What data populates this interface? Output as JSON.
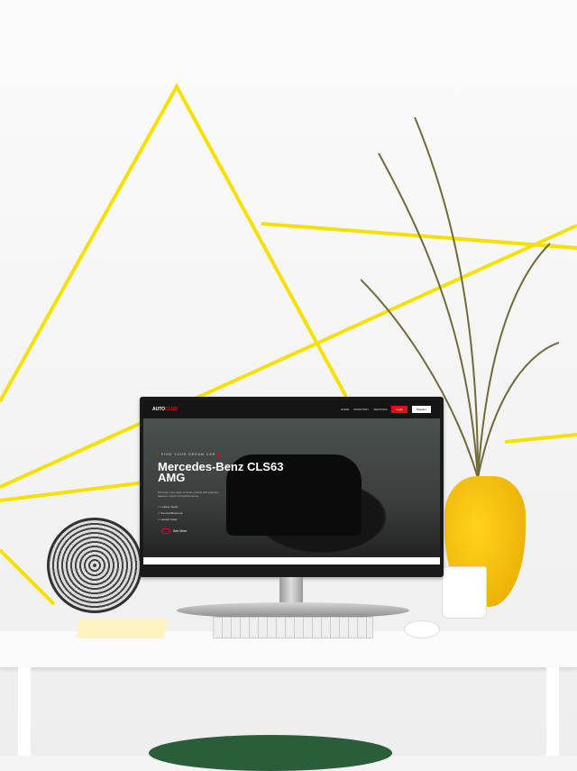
{
  "website": {
    "logo": {
      "part1": "AUTO",
      "part2": "CLUB"
    },
    "nav": {
      "items": [
        "HOME",
        "INVENTORY",
        "SERVICES"
      ],
      "login": "Login",
      "register": "Register"
    },
    "hero": {
      "tagline": "FIND YOUR DREAM CAR",
      "title": "Mercedes-Benz CLS63 AMG",
      "description": "Discover every style of luxury vehicle with premium features, interior and performance.",
      "features": [
        "Leather Seats",
        "Sunroof/Moonroof",
        "Heated Seats"
      ],
      "cta": "See More"
    }
  },
  "colors": {
    "accent": "#e0101a",
    "tape": "#f5e000",
    "vase": "#f5c000"
  }
}
